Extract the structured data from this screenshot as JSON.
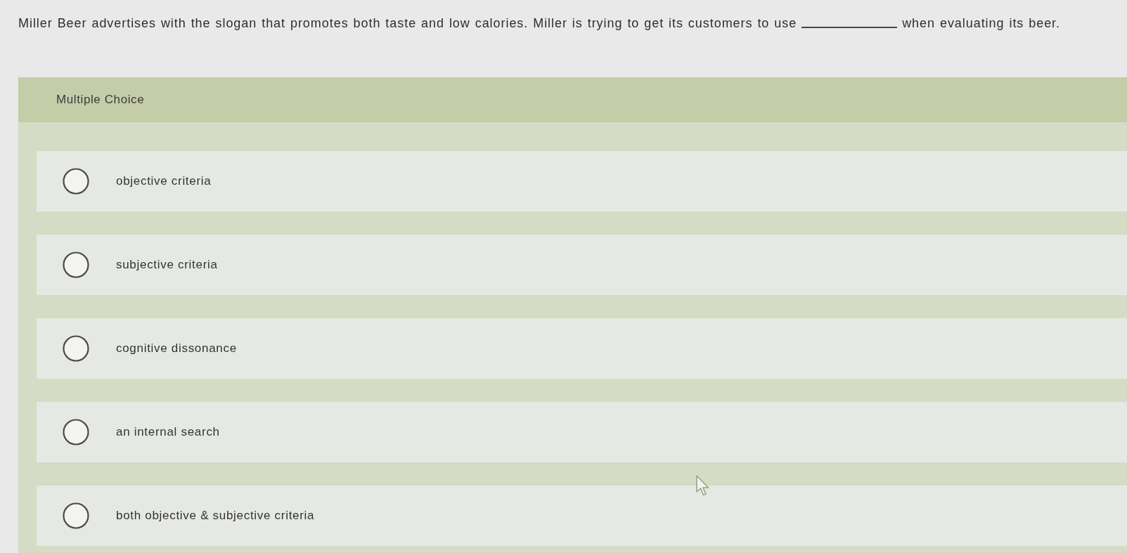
{
  "question": {
    "text_before": "Miller Beer advertises with the slogan that promotes both taste and low calories. Miller is trying to get its customers to use",
    "text_after": "when evaluating its beer."
  },
  "panel": {
    "title": "Multiple Choice",
    "options": [
      {
        "label": "objective criteria",
        "selected": false
      },
      {
        "label": "subjective criteria",
        "selected": false
      },
      {
        "label": "cognitive dissonance",
        "selected": false
      },
      {
        "label": "an internal search",
        "selected": false
      },
      {
        "label": "both objective & subjective criteria",
        "selected": false
      }
    ]
  }
}
